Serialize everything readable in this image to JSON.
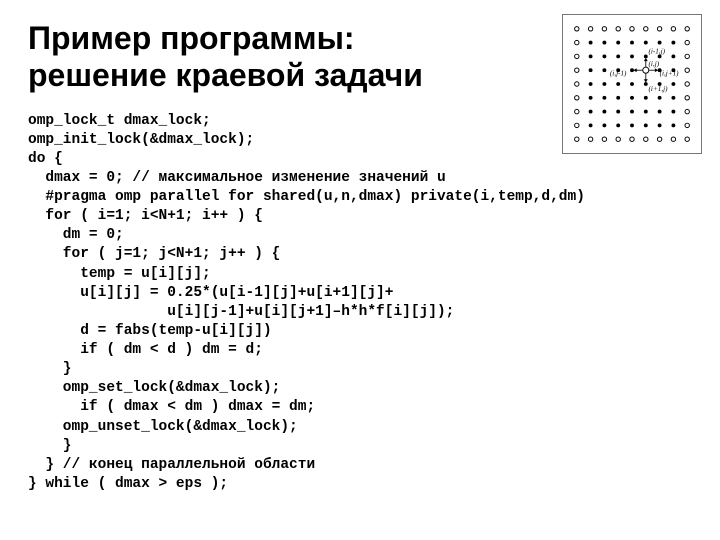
{
  "title_line1": "Пример программы:",
  "title_line2": "решение краевой задачи",
  "code": "omp_lock_t dmax_lock;\nomp_init_lock(&dmax_lock);\ndo {\n  dmax = 0; // максимальное изменение значений u\n  #pragma omp parallel for shared(u,n,dmax) private(i,temp,d,dm)\n  for ( i=1; i<N+1; i++ ) {\n    dm = 0;\n    for ( j=1; j<N+1; j++ ) {\n      temp = u[i][j];\n      u[i][j] = 0.25*(u[i-1][j]+u[i+1][j]+\n                u[i][j-1]+u[i][j+1]–h*h*f[i][j]);\n      d = fabs(temp-u[i][j])\n      if ( dm < d ) dm = d;\n    }\n    omp_set_lock(&dmax_lock);\n      if ( dmax < dm ) dmax = dm;\n    omp_unset_lock(&dmax_lock);\n    }\n  } // конец параллельной области\n} while ( dmax > eps );",
  "stencil": {
    "center": "(i,j)",
    "up": "(i-1,j)",
    "down": "(i+1,j)",
    "left": "(i,j-1)",
    "right": "(i,j+1)"
  }
}
